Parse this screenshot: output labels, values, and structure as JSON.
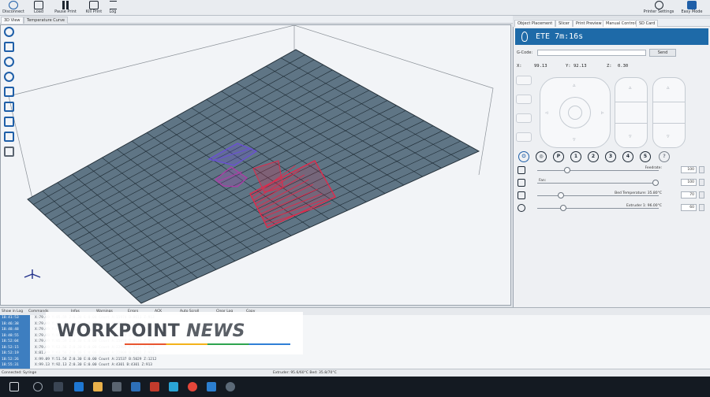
{
  "toolbar": {
    "buttons": [
      {
        "label": "Disconnect",
        "icon": "plug-icon"
      },
      {
        "label": "Load",
        "icon": "folder-icon"
      },
      {
        "label": "Pause Print",
        "icon": "pause-icon"
      },
      {
        "label": "Kill Print",
        "icon": "stop-icon"
      },
      {
        "label": "Log",
        "icon": "log-icon"
      }
    ],
    "right_buttons": [
      {
        "label": "Printer Settings",
        "icon": "gear-icon"
      },
      {
        "label": "Easy Mode",
        "icon": "easy-mode-icon"
      }
    ]
  },
  "left_tabs": [
    "3D View",
    "Temperature Curve"
  ],
  "right_tabs": [
    "Object Placement",
    "Slicer",
    "Print Preview",
    "Manual Control",
    "SD Card"
  ],
  "panel": {
    "eta": "ETE 7m:16s",
    "gcode_label": "G-Code:",
    "gcode_value": "",
    "send_label": "Send",
    "coords": {
      "x_label": "X:",
      "x": "99.13",
      "y_label": "Y:",
      "y": "92.13",
      "z_label": "Z:",
      "z": "0.30"
    },
    "home_buttons": [
      "P",
      "1",
      "2",
      "3",
      "4",
      "5",
      "?"
    ],
    "sliders": [
      {
        "label": "Feedrate:",
        "value": "100",
        "level": 0.25
      },
      {
        "label": "Fan:",
        "value": "100",
        "level": 1.0
      },
      {
        "label": "Bed Temperature: 35.80°C",
        "value": "70",
        "level": 0.2
      },
      {
        "label": "Extruder 1: 96.00°C",
        "value": "60",
        "level": 0.22
      }
    ]
  },
  "log_toolbar": [
    "Show in Log",
    "Commands",
    "Infos",
    "Warnings",
    "Errors",
    "ACK",
    "Auto Scroll",
    "Clear Log",
    "Copy"
  ],
  "log": [
    {
      "time": "18:41:53",
      "text": "X:79.09 Y:85.59 Z:0.30 E:0.00 Count A:15974 B:8611 Z:913"
    },
    {
      "time": "18:46:38",
      "text": "X:79.09 Y:85.59 Z:0.30 E:0.00 Count A:15974 B:8611 Z:913"
    },
    {
      "time": "18:48:48",
      "text": "X:79.09 Y:85.59 Z:0.30 E:0.00 Count A:15974 B:8611 Z:913"
    },
    {
      "time": "18:48:55",
      "text": "X:79.09 Y:85.59 Z:0.30 E:0.00 Count A:15974 B:8611 Z:913"
    },
    {
      "time": "18:52:04",
      "text": "X:79.09 Y:85.59 Z:0.30 E:0.00 Count A:15974 B:8611 Z:913"
    },
    {
      "time": "18:52:15",
      "text": "X:79.09 Y:63.56 Z:0.30 E:0.00 Count A:22909 B:9141 Z:913"
    },
    {
      "time": "18:52:19",
      "text": "X:81.09 Y:63.56 Z:0.30 E:0.00 Count A:22909 B:9161 Z:913"
    },
    {
      "time": "18:52:26",
      "text": "X:99.09 Y:51.54 Z:0.30 E:0.00 Count A:21537 B:5029 Z:1212"
    },
    {
      "time": "18:55:31",
      "text": "X:99.13 Y:92.13 Z:0.30 E:0.00 Count A:4301 B:4301 Z:913"
    }
  ],
  "status": {
    "left": "Connected: Syringe",
    "center": "Extruder: 95.6/60°C Bed: 35.8/70°C"
  },
  "watermark": {
    "brand": "WORKPOINT",
    "suffix": "NEWS"
  },
  "colors": {
    "accent": "#1e6aa8",
    "bed": "#5f7585",
    "grid": "#1d2a33",
    "object_red": "#e0294a",
    "object_purple": "#6a4fd6"
  }
}
